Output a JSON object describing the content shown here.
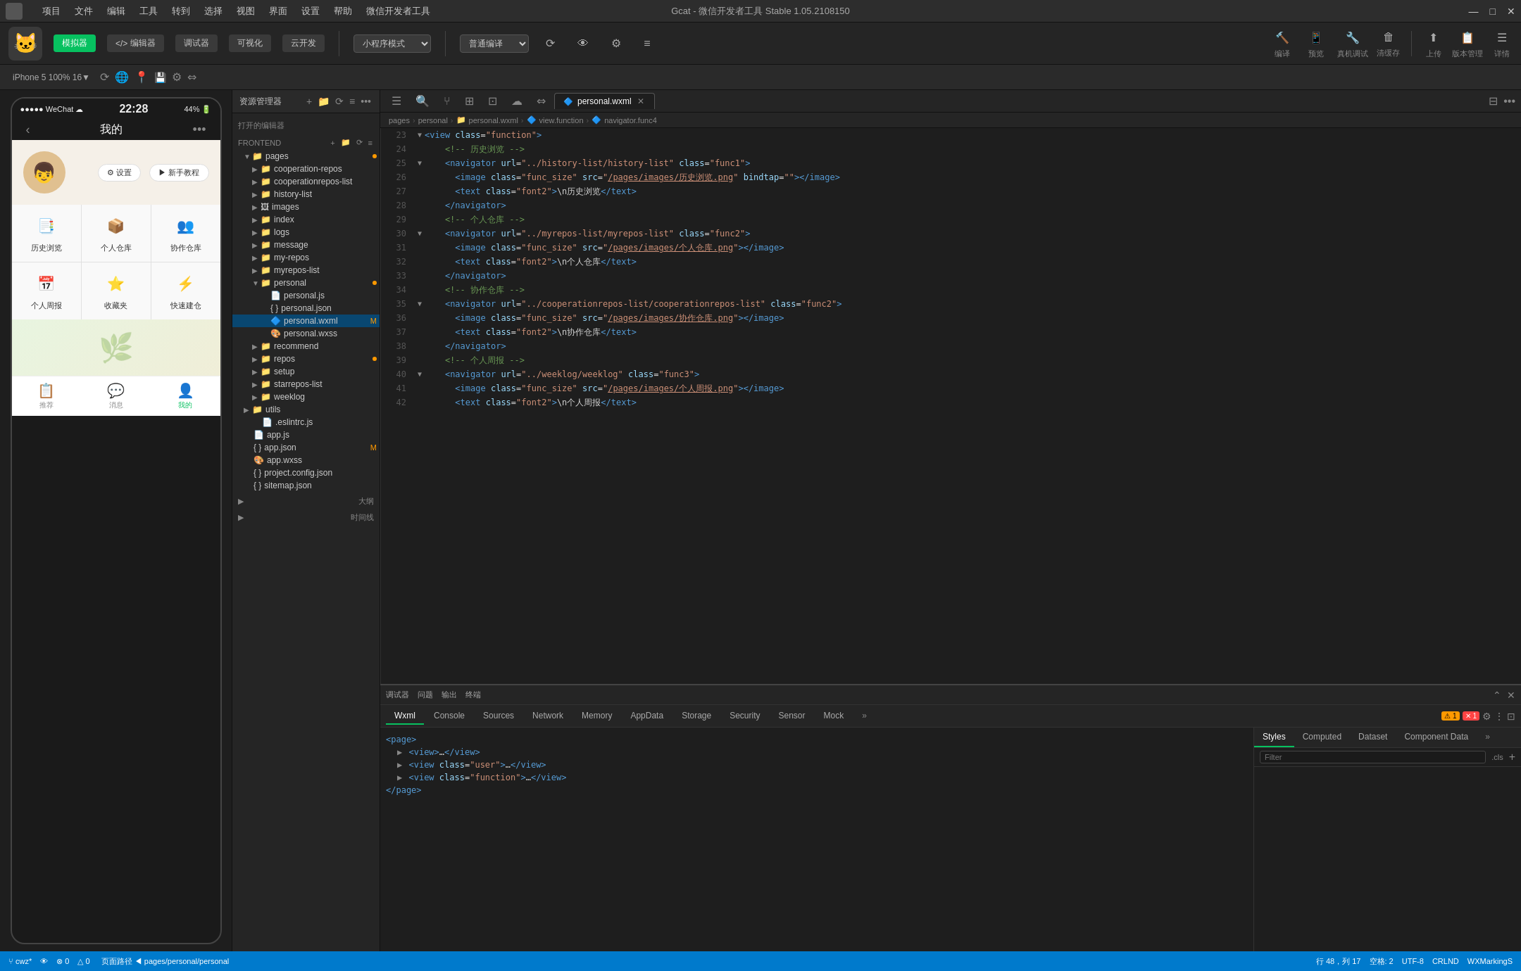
{
  "window": {
    "title": "Gcat - 微信开发者工具 Stable 1.05.2108150",
    "minimize": "—",
    "maximize": "□",
    "close": "✕"
  },
  "menu_bar": {
    "items": [
      "项目",
      "文件",
      "编辑",
      "工具",
      "转到",
      "选择",
      "视图",
      "界面",
      "设置",
      "帮助",
      "微信开发者工具"
    ]
  },
  "toolbar": {
    "simulator_label": "模拟器",
    "editor_label": "编辑器",
    "debugger_label": "调试器",
    "visible_label": "可视化",
    "cloud_label": "云开发",
    "mode_select": "小程序模式",
    "compile_select": "普通编译",
    "compile_btn": "编译",
    "preview_btn": "预览",
    "remote_debug_btn": "真机调试",
    "clear_cache_btn": "清缓存",
    "upload_btn": "上传",
    "version_mgr_btn": "版本管理",
    "details_btn": "详情"
  },
  "sec_toolbar": {
    "phone_info": "iPhone 5  100%  16▼",
    "rotate_icon": "⟳",
    "network_icon": "📶",
    "location_icon": "📍",
    "settings_icon": "⚙"
  },
  "phone": {
    "status_left": "●●●●● WeChat ☁",
    "time": "22:28",
    "status_right": "44%  🔋",
    "nav_title": "我的",
    "nav_dots": "•••",
    "avatar_emoji": "👦",
    "action_settings": "⚙ 设置",
    "action_tutorial": "▶ 新手教程",
    "menu_items": [
      {
        "icon": "📑",
        "label": "历史浏览"
      },
      {
        "icon": "📦",
        "label": "个人仓库"
      },
      {
        "icon": "👥",
        "label": "协作仓库"
      },
      {
        "icon": "📅",
        "label": "个人周报"
      },
      {
        "icon": "⭐",
        "label": "收藏夹"
      },
      {
        "icon": "⚡",
        "label": "快速建仓"
      }
    ],
    "bottom_nav": [
      {
        "icon": "📋",
        "label": "推荐",
        "active": false
      },
      {
        "icon": "💬",
        "label": "消息",
        "active": false
      },
      {
        "icon": "👤",
        "label": "我的",
        "active": true
      }
    ]
  },
  "file_explorer": {
    "title": "资源管理器",
    "section_open_editors": "打开的编辑器",
    "section_frontend": "FRONTEND",
    "files": [
      {
        "name": "pages",
        "type": "folder",
        "indent": 1,
        "expanded": true,
        "badge": "orange"
      },
      {
        "name": "cooperation-repos",
        "type": "folder",
        "indent": 2
      },
      {
        "name": "cooperationrepos-list",
        "type": "folder",
        "indent": 2
      },
      {
        "name": "history-list",
        "type": "folder",
        "indent": 2
      },
      {
        "name": "images",
        "type": "folder",
        "indent": 2
      },
      {
        "name": "index",
        "type": "folder",
        "indent": 2
      },
      {
        "name": "logs",
        "type": "folder",
        "indent": 2
      },
      {
        "name": "message",
        "type": "folder",
        "indent": 2
      },
      {
        "name": "my-repos",
        "type": "folder",
        "indent": 2
      },
      {
        "name": "myrepos-list",
        "type": "folder",
        "indent": 2
      },
      {
        "name": "personal",
        "type": "folder",
        "indent": 2,
        "expanded": true,
        "badge": "orange"
      },
      {
        "name": "personal.js",
        "type": "js",
        "indent": 3
      },
      {
        "name": "personal.json",
        "type": "json",
        "indent": 3
      },
      {
        "name": "personal.wxml",
        "type": "wxml",
        "indent": 3,
        "selected": true,
        "modified": "M"
      },
      {
        "name": "personal.wxss",
        "type": "wxss",
        "indent": 3
      },
      {
        "name": "recommend",
        "type": "folder",
        "indent": 2
      },
      {
        "name": "repos",
        "type": "folder",
        "indent": 2,
        "badge": "orange"
      },
      {
        "name": "setup",
        "type": "folder",
        "indent": 2
      },
      {
        "name": "starrepos-list",
        "type": "folder",
        "indent": 2
      },
      {
        "name": "weeklog",
        "type": "folder",
        "indent": 2
      },
      {
        "name": "utils",
        "type": "folder",
        "indent": 1
      },
      {
        "name": ".eslintrc.js",
        "type": "js",
        "indent": 2
      },
      {
        "name": "app.js",
        "type": "js",
        "indent": 1
      },
      {
        "name": "app.json",
        "type": "json",
        "indent": 1,
        "modified": "M"
      },
      {
        "name": "app.wxss",
        "type": "wxss",
        "indent": 1
      },
      {
        "name": "project.config.json",
        "type": "json",
        "indent": 1
      },
      {
        "name": "sitemap.json",
        "type": "json",
        "indent": 1
      }
    ],
    "section_outline": "大纲",
    "section_timeline": "时间线"
  },
  "editor": {
    "tab_name": "personal.wxml",
    "tab_icon": "🔷",
    "breadcrumb": [
      "pages",
      "personal",
      "personal.wxml",
      "view.function",
      "navigator.func4"
    ],
    "lines": [
      {
        "num": 23,
        "fold": true,
        "code": "  <view class=\"function\">"
      },
      {
        "num": 24,
        "fold": false,
        "code": "    <!-- 历史浏览 -->"
      },
      {
        "num": 25,
        "fold": true,
        "code": "    <navigator url=\"../history-list/history-list\" class=\"func1\">"
      },
      {
        "num": 26,
        "fold": false,
        "code": "      <image class=\"func_size\" src=\"/pages/images/历史浏览.png\" bindtap=\"\"></image>"
      },
      {
        "num": 27,
        "fold": false,
        "code": "      <text class=\"font2\">\\n历史浏览</text>"
      },
      {
        "num": 28,
        "fold": false,
        "code": "    </navigator>"
      },
      {
        "num": 29,
        "fold": false,
        "code": "    <!-- 个人仓库 -->"
      },
      {
        "num": 30,
        "fold": true,
        "code": "    <navigator url=\"../myrepos-list/myrepos-list\" class=\"func2\">"
      },
      {
        "num": 31,
        "fold": false,
        "code": "      <image class=\"func_size\" src=\"/pages/images/个人仓库.png\"></image>"
      },
      {
        "num": 32,
        "fold": false,
        "code": "      <text class=\"font2\">\\n个人仓库</text>"
      },
      {
        "num": 33,
        "fold": false,
        "code": "    </navigator>"
      },
      {
        "num": 34,
        "fold": false,
        "code": "    <!-- 协作仓库 -->"
      },
      {
        "num": 35,
        "fold": true,
        "code": "    <navigator url=\"../cooperationrepos-list/cooperationrepos-list\" class=\"func2\">"
      },
      {
        "num": 36,
        "fold": false,
        "code": "      <image class=\"func_size\" src=\"/pages/images/协作仓库.png\"></image>"
      },
      {
        "num": 37,
        "fold": false,
        "code": "      <text class=\"font2\">\\n协作仓库</text>"
      },
      {
        "num": 38,
        "fold": false,
        "code": "    </navigator>"
      },
      {
        "num": 39,
        "fold": false,
        "code": "    <!-- 个人周报 -->"
      },
      {
        "num": 40,
        "fold": true,
        "code": "    <navigator url=\"../weeklog/weeklog\" class=\"func3\">"
      },
      {
        "num": 41,
        "fold": false,
        "code": "      <image class=\"func_size\" src=\"/pages/images/个人周报.png\"></image>"
      },
      {
        "num": 42,
        "fold": false,
        "code": "      <text class=\"font2\">\\n个人周报</text>"
      }
    ]
  },
  "devtools": {
    "toolbar_label": "调试器",
    "issue_label": "问题",
    "output_label": "输出",
    "terminal_label": "终端",
    "tabs": [
      "Wxml",
      "Console",
      "Sources",
      "Network",
      "Memory",
      "AppData",
      "Storage",
      "Security",
      "Sensor",
      "Mock"
    ],
    "active_tab": "Wxml",
    "more_tabs": "»",
    "warning_count": "1",
    "error_count": "1",
    "dom_tree": [
      {
        "level": 0,
        "text": "<page>"
      },
      {
        "level": 1,
        "text": "▶ <view>…</view>"
      },
      {
        "level": 1,
        "text": "▶ <view class=\"user\">…</view>"
      },
      {
        "level": 1,
        "text": "▶ <view class=\"function\">…</view>"
      },
      {
        "level": 0,
        "text": "</page>"
      }
    ],
    "right_tabs": [
      "Styles",
      "Computed",
      "Dataset",
      "Component Data"
    ],
    "active_right_tab": "Styles",
    "styles_filter_placeholder": "Filter",
    "styles_cls": ".cls",
    "styles_add": "+"
  },
  "status_bar": {
    "branch": "cwz*",
    "errors": "⊗ 0",
    "warnings": "△ 0",
    "path": "页面路径 ◀  pages/personal/personal",
    "row": "行 48，列 17",
    "spaces": "空格: 2",
    "encoding": "UTF-8",
    "line_ending": "CRLND",
    "language": "WXMarkingS",
    "preview_icon": "👁",
    "settings_icon": "⚙",
    "more_icon": "···"
  },
  "colors": {
    "accent": "#07c160",
    "status_bar_bg": "#007acc",
    "editor_bg": "#1e1e1e",
    "sidebar_bg": "#252525",
    "selected_bg": "#094771"
  }
}
